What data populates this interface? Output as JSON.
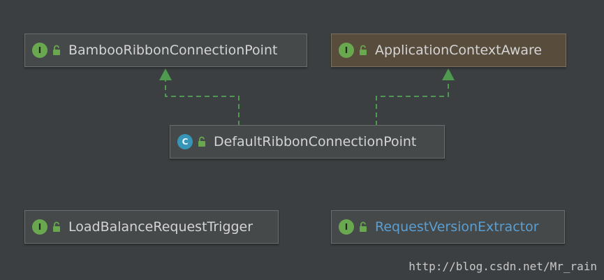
{
  "nodes": [
    {
      "id": "bamboo",
      "kind": "interface",
      "badge": "I",
      "label": "BambooRibbonConnectionPoint"
    },
    {
      "id": "appctx",
      "kind": "interface",
      "badge": "I",
      "label": "ApplicationContextAware"
    },
    {
      "id": "default",
      "kind": "class",
      "badge": "C",
      "label": "DefaultRibbonConnectionPoint"
    },
    {
      "id": "loadbalance",
      "kind": "interface",
      "badge": "I",
      "label": "LoadBalanceRequestTrigger"
    },
    {
      "id": "versionextractor",
      "kind": "interface",
      "badge": "I",
      "label": "RequestVersionExtractor"
    }
  ],
  "edges": [
    {
      "from": "default",
      "to": "bamboo",
      "style": "dashed",
      "arrow": "hollow-implements"
    },
    {
      "from": "default",
      "to": "appctx",
      "style": "dashed",
      "arrow": "hollow-implements"
    }
  ],
  "colors": {
    "background": "#3c3f41",
    "node_fill": "#45494a",
    "node_fill_highlight": "#584c3c",
    "edge": "#4e9a4e",
    "interface_badge": "#6aa84f",
    "class_badge": "#3796b8",
    "link_text": "#5a9fd4"
  },
  "watermark": "http://blog.csdn.net/Mr_rain"
}
